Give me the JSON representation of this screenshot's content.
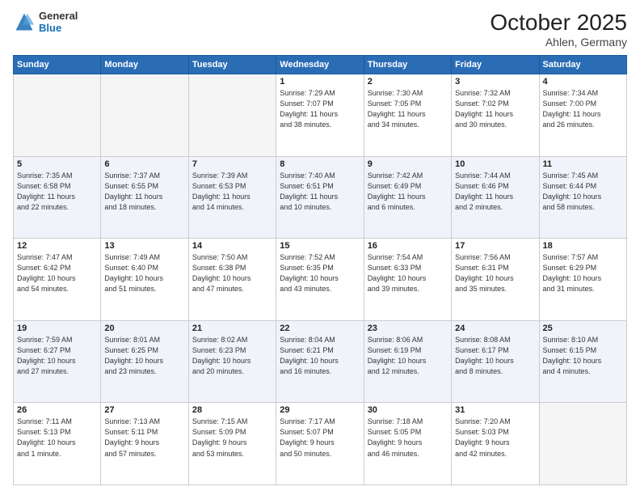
{
  "header": {
    "logo_general": "General",
    "logo_blue": "Blue",
    "month": "October 2025",
    "location": "Ahlen, Germany"
  },
  "days_of_week": [
    "Sunday",
    "Monday",
    "Tuesday",
    "Wednesday",
    "Thursday",
    "Friday",
    "Saturday"
  ],
  "weeks": [
    [
      {
        "num": "",
        "info": ""
      },
      {
        "num": "",
        "info": ""
      },
      {
        "num": "",
        "info": ""
      },
      {
        "num": "1",
        "info": "Sunrise: 7:29 AM\nSunset: 7:07 PM\nDaylight: 11 hours\nand 38 minutes."
      },
      {
        "num": "2",
        "info": "Sunrise: 7:30 AM\nSunset: 7:05 PM\nDaylight: 11 hours\nand 34 minutes."
      },
      {
        "num": "3",
        "info": "Sunrise: 7:32 AM\nSunset: 7:02 PM\nDaylight: 11 hours\nand 30 minutes."
      },
      {
        "num": "4",
        "info": "Sunrise: 7:34 AM\nSunset: 7:00 PM\nDaylight: 11 hours\nand 26 minutes."
      }
    ],
    [
      {
        "num": "5",
        "info": "Sunrise: 7:35 AM\nSunset: 6:58 PM\nDaylight: 11 hours\nand 22 minutes."
      },
      {
        "num": "6",
        "info": "Sunrise: 7:37 AM\nSunset: 6:55 PM\nDaylight: 11 hours\nand 18 minutes."
      },
      {
        "num": "7",
        "info": "Sunrise: 7:39 AM\nSunset: 6:53 PM\nDaylight: 11 hours\nand 14 minutes."
      },
      {
        "num": "8",
        "info": "Sunrise: 7:40 AM\nSunset: 6:51 PM\nDaylight: 11 hours\nand 10 minutes."
      },
      {
        "num": "9",
        "info": "Sunrise: 7:42 AM\nSunset: 6:49 PM\nDaylight: 11 hours\nand 6 minutes."
      },
      {
        "num": "10",
        "info": "Sunrise: 7:44 AM\nSunset: 6:46 PM\nDaylight: 11 hours\nand 2 minutes."
      },
      {
        "num": "11",
        "info": "Sunrise: 7:45 AM\nSunset: 6:44 PM\nDaylight: 10 hours\nand 58 minutes."
      }
    ],
    [
      {
        "num": "12",
        "info": "Sunrise: 7:47 AM\nSunset: 6:42 PM\nDaylight: 10 hours\nand 54 minutes."
      },
      {
        "num": "13",
        "info": "Sunrise: 7:49 AM\nSunset: 6:40 PM\nDaylight: 10 hours\nand 51 minutes."
      },
      {
        "num": "14",
        "info": "Sunrise: 7:50 AM\nSunset: 6:38 PM\nDaylight: 10 hours\nand 47 minutes."
      },
      {
        "num": "15",
        "info": "Sunrise: 7:52 AM\nSunset: 6:35 PM\nDaylight: 10 hours\nand 43 minutes."
      },
      {
        "num": "16",
        "info": "Sunrise: 7:54 AM\nSunset: 6:33 PM\nDaylight: 10 hours\nand 39 minutes."
      },
      {
        "num": "17",
        "info": "Sunrise: 7:56 AM\nSunset: 6:31 PM\nDaylight: 10 hours\nand 35 minutes."
      },
      {
        "num": "18",
        "info": "Sunrise: 7:57 AM\nSunset: 6:29 PM\nDaylight: 10 hours\nand 31 minutes."
      }
    ],
    [
      {
        "num": "19",
        "info": "Sunrise: 7:59 AM\nSunset: 6:27 PM\nDaylight: 10 hours\nand 27 minutes."
      },
      {
        "num": "20",
        "info": "Sunrise: 8:01 AM\nSunset: 6:25 PM\nDaylight: 10 hours\nand 23 minutes."
      },
      {
        "num": "21",
        "info": "Sunrise: 8:02 AM\nSunset: 6:23 PM\nDaylight: 10 hours\nand 20 minutes."
      },
      {
        "num": "22",
        "info": "Sunrise: 8:04 AM\nSunset: 6:21 PM\nDaylight: 10 hours\nand 16 minutes."
      },
      {
        "num": "23",
        "info": "Sunrise: 8:06 AM\nSunset: 6:19 PM\nDaylight: 10 hours\nand 12 minutes."
      },
      {
        "num": "24",
        "info": "Sunrise: 8:08 AM\nSunset: 6:17 PM\nDaylight: 10 hours\nand 8 minutes."
      },
      {
        "num": "25",
        "info": "Sunrise: 8:10 AM\nSunset: 6:15 PM\nDaylight: 10 hours\nand 4 minutes."
      }
    ],
    [
      {
        "num": "26",
        "info": "Sunrise: 7:11 AM\nSunset: 5:13 PM\nDaylight: 10 hours\nand 1 minute."
      },
      {
        "num": "27",
        "info": "Sunrise: 7:13 AM\nSunset: 5:11 PM\nDaylight: 9 hours\nand 57 minutes."
      },
      {
        "num": "28",
        "info": "Sunrise: 7:15 AM\nSunset: 5:09 PM\nDaylight: 9 hours\nand 53 minutes."
      },
      {
        "num": "29",
        "info": "Sunrise: 7:17 AM\nSunset: 5:07 PM\nDaylight: 9 hours\nand 50 minutes."
      },
      {
        "num": "30",
        "info": "Sunrise: 7:18 AM\nSunset: 5:05 PM\nDaylight: 9 hours\nand 46 minutes."
      },
      {
        "num": "31",
        "info": "Sunrise: 7:20 AM\nSunset: 5:03 PM\nDaylight: 9 hours\nand 42 minutes."
      },
      {
        "num": "",
        "info": ""
      }
    ]
  ]
}
